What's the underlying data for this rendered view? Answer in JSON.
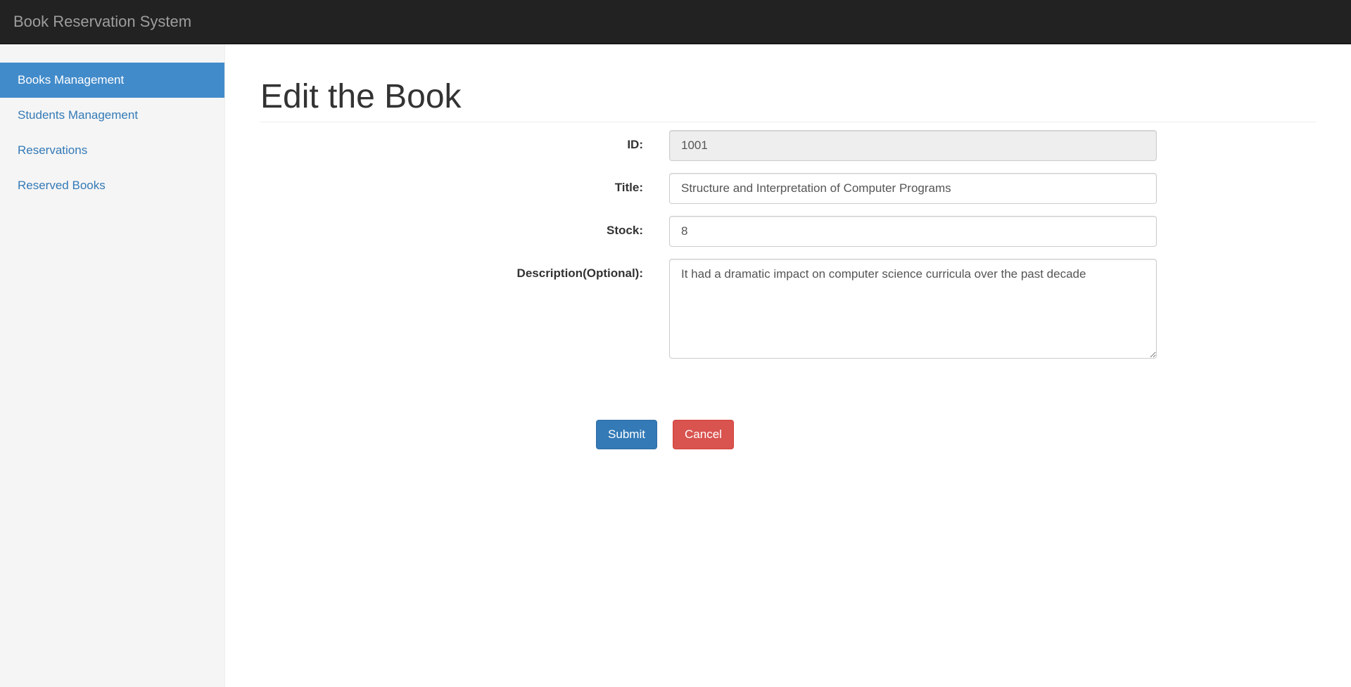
{
  "app": {
    "brand": "Book Reservation System"
  },
  "sidebar": {
    "items": [
      {
        "label": "Books Management",
        "active": true
      },
      {
        "label": "Students Management",
        "active": false
      },
      {
        "label": "Reservations",
        "active": false
      },
      {
        "label": "Reserved Books",
        "active": false
      }
    ]
  },
  "page": {
    "title": "Edit the Book"
  },
  "form": {
    "id_label": "ID:",
    "id_value": "1001",
    "title_label": "Title:",
    "title_value": "Structure and Interpretation of Computer Programs",
    "stock_label": "Stock:",
    "stock_value": "8",
    "description_label": "Description(Optional):",
    "description_value": "It had a dramatic impact on computer science curricula over the past decade",
    "submit_label": "Submit",
    "cancel_label": "Cancel"
  },
  "colors": {
    "navbar": "#222222",
    "sidebar": "#f5f5f5",
    "active": "#428bca",
    "link": "#337ab7",
    "primary": "#337ab7",
    "danger": "#d9534f"
  }
}
